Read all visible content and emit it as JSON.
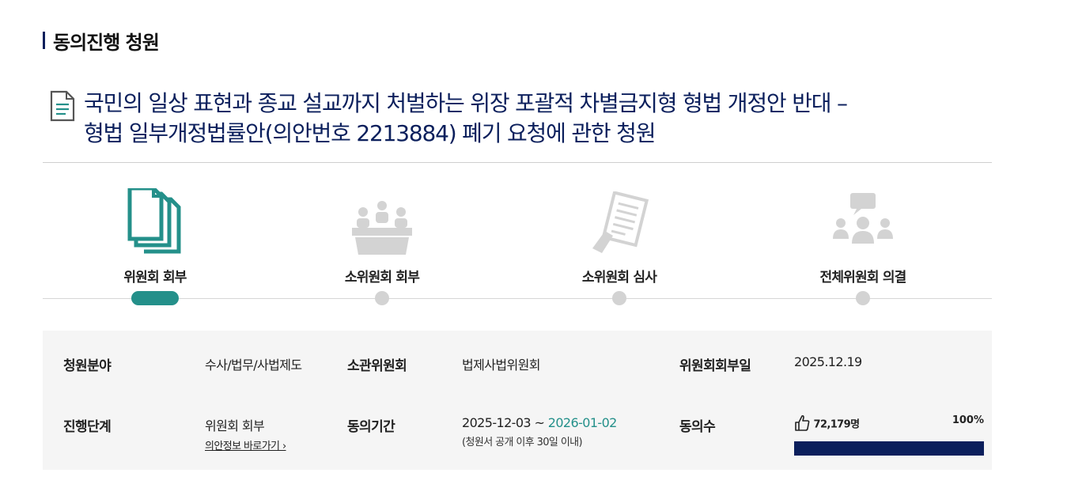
{
  "section": {
    "title": "동의진행 청원"
  },
  "petition": {
    "icon": "document-icon",
    "title_line1": "국민의 일상 표현과 종교 설교까지 처벌하는 위장 포괄적 차별금지형 형법 개정안 반대 –",
    "title_line2": "형법 일부개정법률안(의안번호 2213884) 폐기 요청에 관한 청원"
  },
  "steps": [
    {
      "label": "위원회 회부",
      "icon": "documents-icon",
      "active": true
    },
    {
      "label": "소위원회 회부",
      "icon": "meeting-icon",
      "active": false
    },
    {
      "label": "소위원회 심사",
      "icon": "review-document-icon",
      "active": false
    },
    {
      "label": "전체위원회 의결",
      "icon": "discussion-icon",
      "active": false
    }
  ],
  "info": {
    "field_label": "청원분야",
    "field_value": "수사/법무/사법제도",
    "committee_label": "소관위원회",
    "committee_value": "법제사법위원회",
    "referral_label": "위원회회부일",
    "referral_value": "2025.12.19",
    "stage_label": "진행단계",
    "stage_value": "위원회 회부",
    "stage_link": "의안정보 바로가기 ›",
    "period_label": "동의기간",
    "period_start": "2025-12-03 ~ ",
    "period_end": "2026-01-02",
    "period_note": "(청원서 공개 이후 30일 이내)",
    "agree_label": "동의수",
    "agree_icon": "thumbs-up-icon",
    "agree_count": "72,179명",
    "agree_percent_label": "100%",
    "agree_progress": 1.0
  },
  "colors": {
    "navy": "#0b1f5c",
    "teal": "#24908a",
    "gray": "#d3d3d3"
  }
}
